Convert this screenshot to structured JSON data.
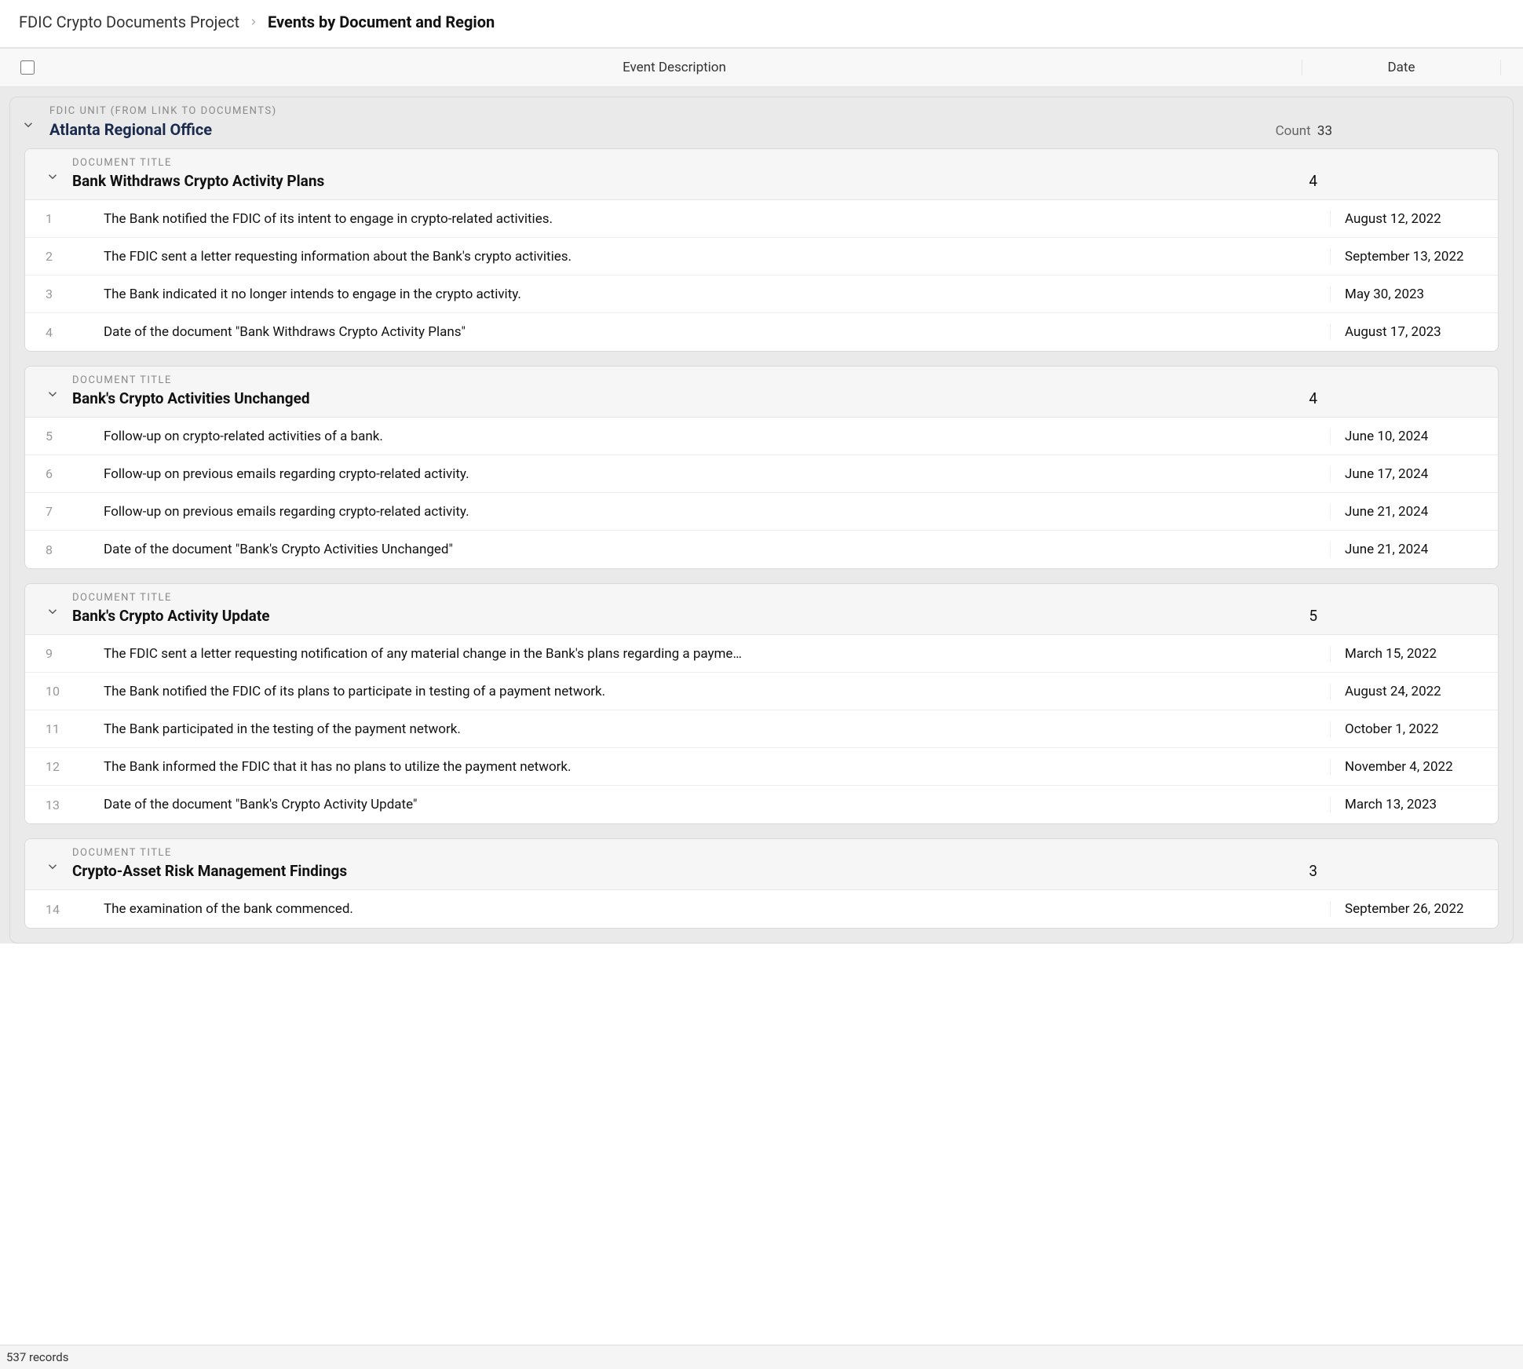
{
  "breadcrumb": {
    "project": "FDIC Crypto Documents Project",
    "view": "Events by Document and Region"
  },
  "columns": {
    "desc": "Event Description",
    "date": "Date"
  },
  "region_label": "FDIC UNIT (FROM LINK TO DOCUMENTS)",
  "doc_label": "DOCUMENT TITLE",
  "count_label": "Count",
  "regions": [
    {
      "name": "Atlanta Regional Office",
      "count": "33",
      "docs": [
        {
          "title": "Bank Withdraws Crypto Activity Plans",
          "count": "4",
          "rows": [
            {
              "n": "1",
              "desc": "The Bank notified the FDIC of its intent to engage in crypto-related activities.",
              "date": "August 12, 2022"
            },
            {
              "n": "2",
              "desc": "The FDIC sent a letter requesting information about the Bank's crypto activities.",
              "date": "September 13, 2022"
            },
            {
              "n": "3",
              "desc": "The Bank indicated it no longer intends to engage in the crypto activity.",
              "date": "May 30, 2023"
            },
            {
              "n": "4",
              "desc": "Date of the document \"Bank Withdraws Crypto Activity Plans\"",
              "date": "August 17, 2023"
            }
          ]
        },
        {
          "title": "Bank's Crypto Activities Unchanged",
          "count": "4",
          "rows": [
            {
              "n": "5",
              "desc": "Follow-up on crypto-related activities of a bank.",
              "date": "June 10, 2024"
            },
            {
              "n": "6",
              "desc": "Follow-up on previous emails regarding crypto-related activity.",
              "date": "June 17, 2024"
            },
            {
              "n": "7",
              "desc": "Follow-up on previous emails regarding crypto-related activity.",
              "date": "June 21, 2024"
            },
            {
              "n": "8",
              "desc": "Date of the document \"Bank's Crypto Activities Unchanged\"",
              "date": "June 21, 2024"
            }
          ]
        },
        {
          "title": "Bank's Crypto Activity Update",
          "count": "5",
          "rows": [
            {
              "n": "9",
              "desc": "The FDIC sent a letter requesting notification of any material change in the Bank's plans regarding a payme…",
              "date": "March 15, 2022"
            },
            {
              "n": "10",
              "desc": "The Bank notified the FDIC of its plans to participate in testing of a payment network.",
              "date": "August 24, 2022"
            },
            {
              "n": "11",
              "desc": "The Bank participated in the testing of the payment network.",
              "date": "October 1, 2022"
            },
            {
              "n": "12",
              "desc": "The Bank informed the FDIC that it has no plans to utilize the payment network.",
              "date": "November 4, 2022"
            },
            {
              "n": "13",
              "desc": "Date of the document \"Bank's Crypto Activity Update\"",
              "date": "March 13, 2023"
            }
          ]
        },
        {
          "title": "Crypto-Asset Risk Management Findings",
          "count": "3",
          "rows": [
            {
              "n": "14",
              "desc": "The examination of the bank commenced.",
              "date": "September 26, 2022"
            }
          ]
        }
      ]
    }
  ],
  "footer": {
    "records": "537 records"
  }
}
